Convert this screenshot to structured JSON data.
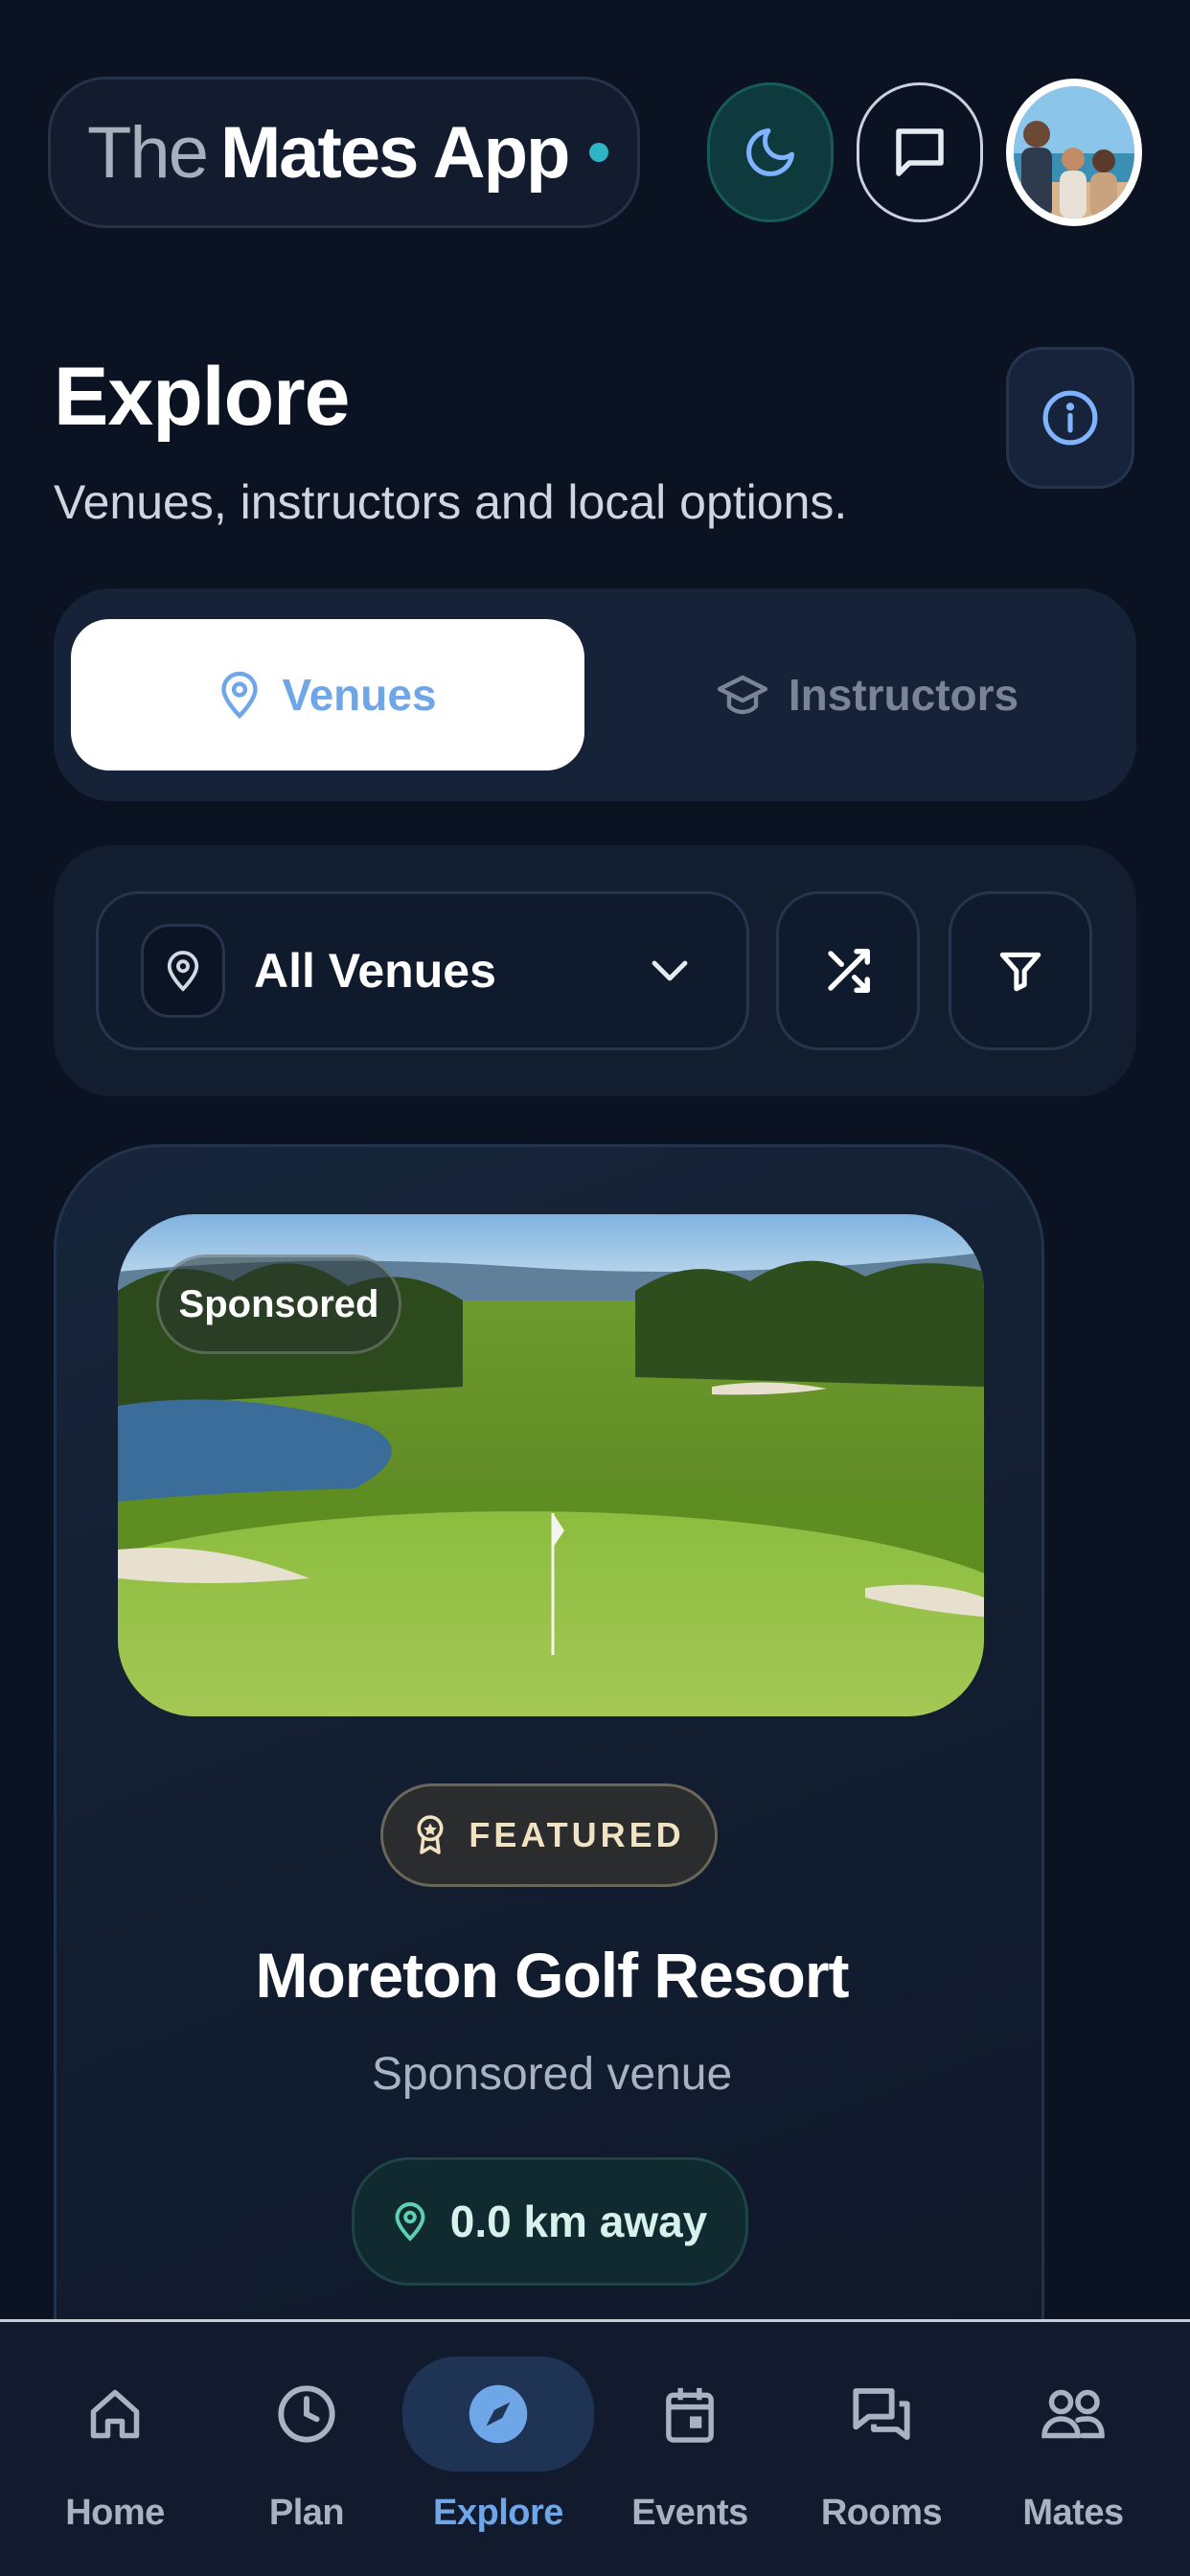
{
  "header": {
    "brand_prefix": "The",
    "brand_name": "Mates App",
    "theme_icon": "moon-icon",
    "messages_icon": "chat-icon",
    "avatar_icon": "user-avatar"
  },
  "explore": {
    "title": "Explore",
    "subtitle": "Venues, instructors and local options.",
    "info_icon": "info-icon"
  },
  "tabs": [
    {
      "label": "Venues",
      "icon": "map-pin-icon",
      "active": true
    },
    {
      "label": "Instructors",
      "icon": "graduation-cap-icon",
      "active": false
    }
  ],
  "filters": {
    "selected_venue": "All Venues",
    "shuffle_icon": "shuffle-icon",
    "filter_icon": "filter-icon"
  },
  "venue_card": {
    "image_badge": "Sponsored",
    "featured_label": "FEATURED",
    "name": "Moreton Golf Resort",
    "subtitle": "Sponsored venue",
    "distance": "0.0 km away"
  },
  "bottom_nav": [
    {
      "label": "Home",
      "icon": "home-icon",
      "active": false
    },
    {
      "label": "Plan",
      "icon": "clock-icon",
      "active": false
    },
    {
      "label": "Explore",
      "icon": "compass-icon",
      "active": true
    },
    {
      "label": "Events",
      "icon": "calendar-icon",
      "active": false
    },
    {
      "label": "Rooms",
      "icon": "chat-bubbles-icon",
      "active": false
    },
    {
      "label": "Mates",
      "icon": "people-icon",
      "active": false
    }
  ],
  "colors": {
    "background": "#0b1322",
    "accent_blue": "#6fa6e8",
    "accent_teal": "#2fb3c7",
    "featured_text": "#f1e2c2",
    "distance_pin": "#5fd1b3"
  }
}
